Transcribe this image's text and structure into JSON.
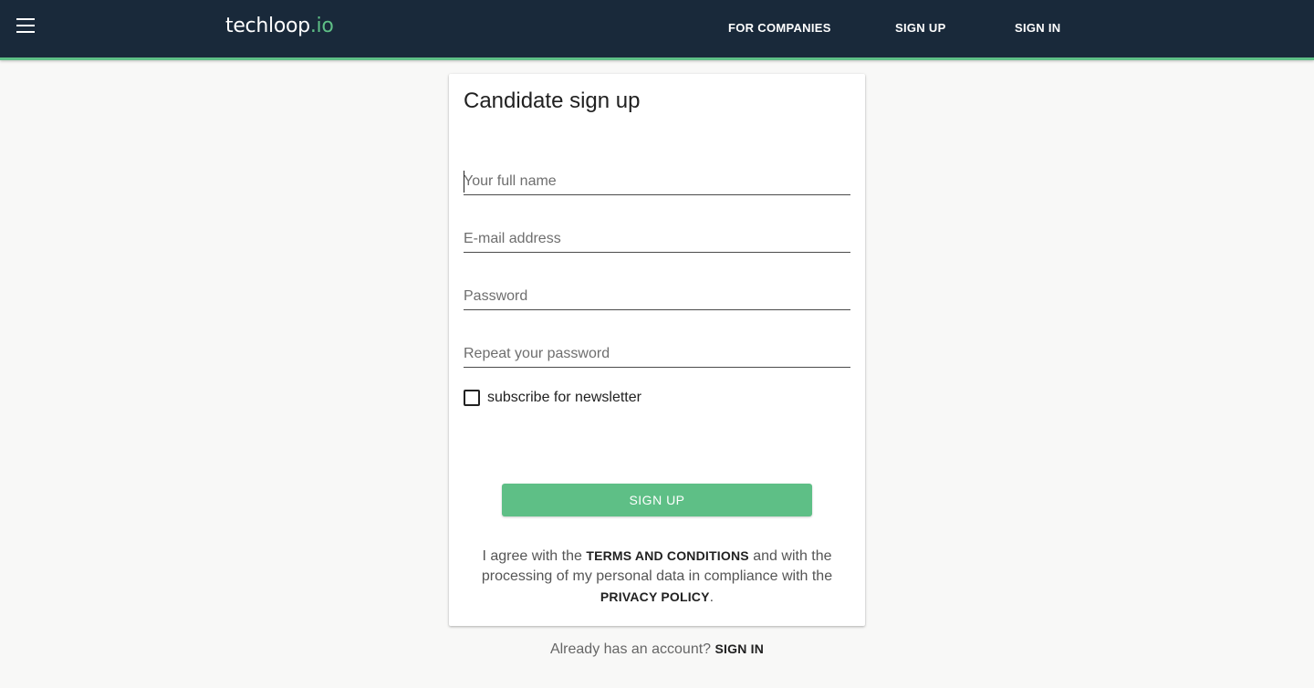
{
  "header": {
    "logo_main": "techloop",
    "logo_tld": ".io",
    "nav": {
      "for_companies": "FOR COMPANIES",
      "sign_up": "SIGN UP",
      "sign_in": "SIGN IN"
    }
  },
  "form": {
    "title": "Candidate sign up",
    "fields": {
      "full_name": {
        "placeholder": "Your full name",
        "value": ""
      },
      "email": {
        "placeholder": "E-mail address",
        "value": ""
      },
      "password": {
        "placeholder": "Password",
        "value": ""
      },
      "repeat_password": {
        "placeholder": "Repeat your password",
        "value": ""
      }
    },
    "newsletter": {
      "label": "subscribe for newsletter",
      "checked": false
    },
    "submit_label": "SIGN UP",
    "agreement": {
      "part1": "I agree with the ",
      "terms_link": "TERMS AND CONDITIONS",
      "part2": " and with the processing of my personal data in compliance with the ",
      "privacy_link": "PRIVACY POLICY",
      "part3": "."
    }
  },
  "footer": {
    "question": "Already has an account? ",
    "sign_in_link": "SIGN IN"
  },
  "colors": {
    "navbar_bg": "#19293a",
    "accent_green": "#5ebf86",
    "page_bg": "#f8f8f7"
  },
  "icons": {
    "menu": "hamburger-menu-icon"
  }
}
